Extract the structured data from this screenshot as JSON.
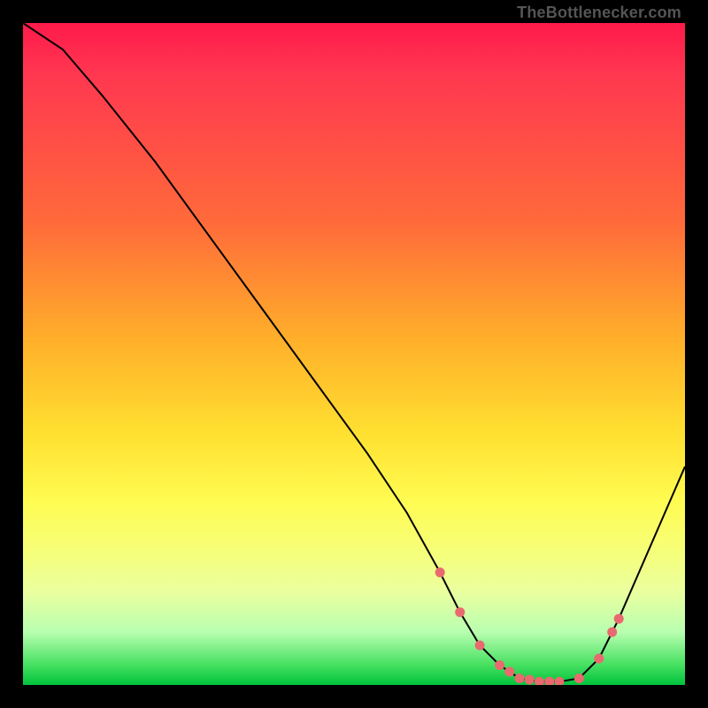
{
  "watermark": "TheBottlenecker.com",
  "chart_data": {
    "type": "line",
    "x_range": [
      0,
      100
    ],
    "y_range": [
      0,
      100
    ],
    "title": "",
    "xlabel": "",
    "ylabel": "",
    "series": [
      {
        "name": "bottleneck-curve",
        "x": [
          0,
          6,
          12,
          20,
          28,
          36,
          44,
          52,
          58,
          63,
          66,
          69,
          72,
          75,
          78,
          81,
          84,
          87,
          90,
          100
        ],
        "y": [
          100,
          96,
          89,
          79,
          68,
          57,
          46,
          35,
          26,
          17,
          11,
          6,
          3,
          1,
          0.5,
          0.5,
          1,
          4,
          10,
          33
        ]
      }
    ],
    "markers": {
      "name": "highlight-points",
      "color": "#e86a6f",
      "x": [
        63,
        66,
        69,
        72,
        73.5,
        75,
        76.5,
        78,
        79.5,
        81,
        84,
        87,
        89,
        90
      ],
      "y": [
        17,
        11,
        6,
        3,
        2,
        1,
        0.8,
        0.5,
        0.5,
        0.5,
        1,
        4,
        8,
        10
      ]
    },
    "gradient_stops": [
      {
        "pos": 0,
        "color": "#ff1a4b"
      },
      {
        "pos": 30,
        "color": "#ff6a3a"
      },
      {
        "pos": 62,
        "color": "#ffe030"
      },
      {
        "pos": 86,
        "color": "#eaffa0"
      },
      {
        "pos": 100,
        "color": "#00c23c"
      }
    ]
  }
}
